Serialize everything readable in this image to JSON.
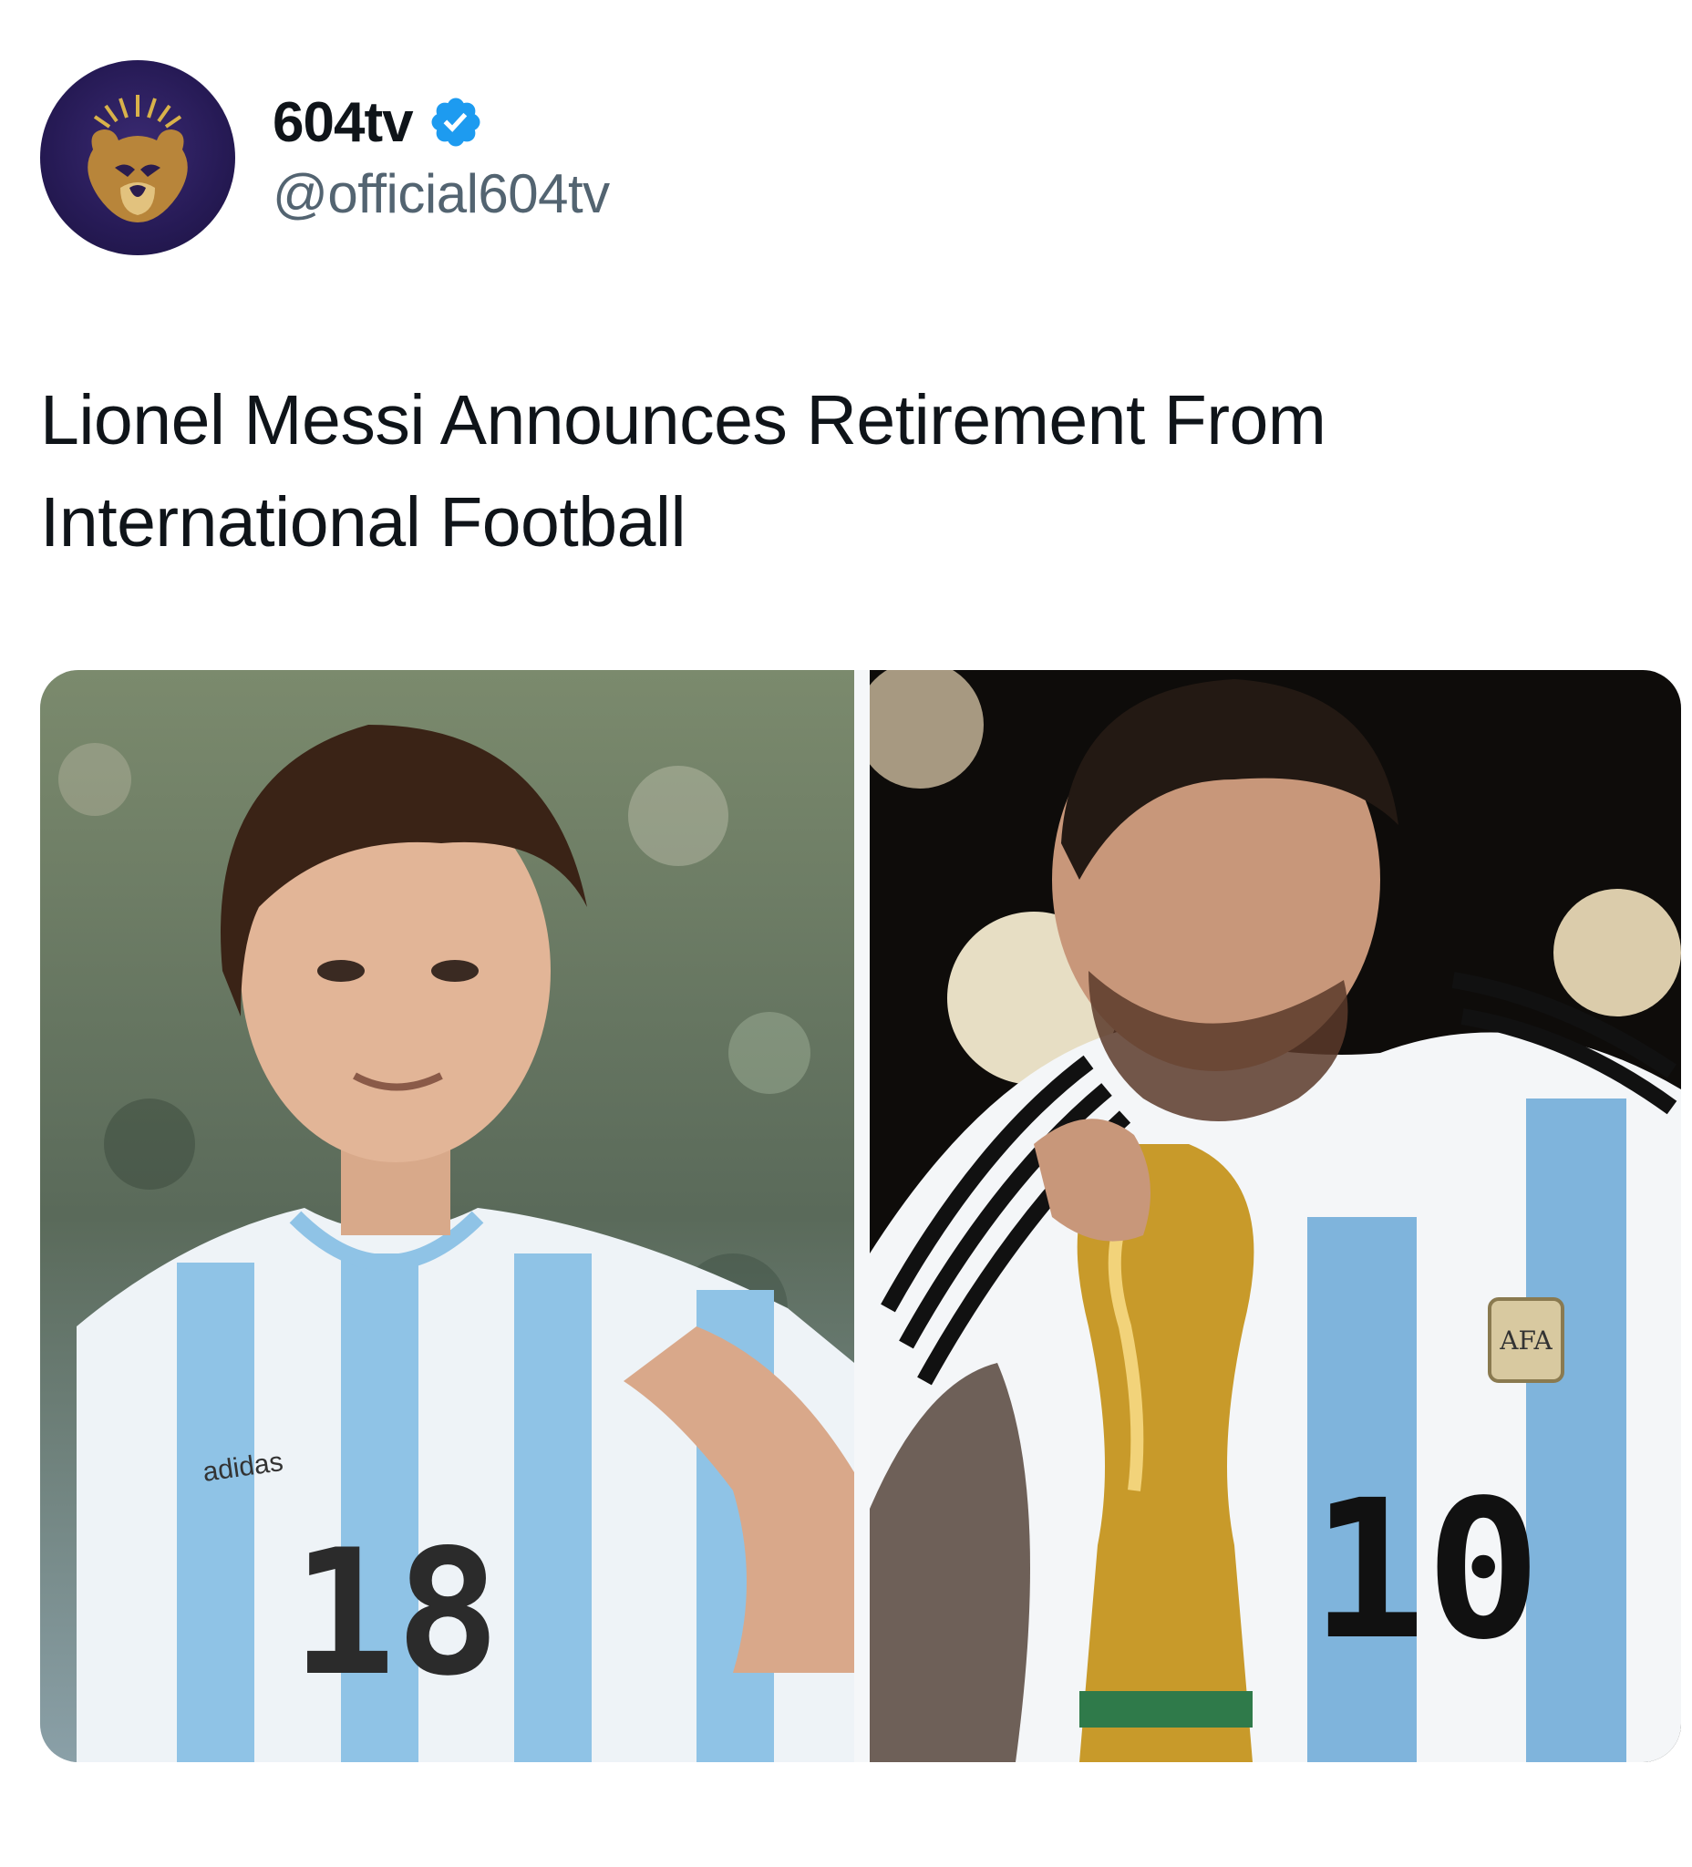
{
  "account": {
    "display_name": "604tv",
    "handle": "@official604tv",
    "verified": true,
    "avatar_icon": "bear-crown-logo-icon",
    "verified_icon": "verified-badge-icon",
    "colors": {
      "verified": "#1d9bf0",
      "avatar_bg": "#261a55",
      "avatar_logo": "#c79a3e"
    }
  },
  "tweet": {
    "text": "Lionel Messi Announces Retirement From International Football"
  },
  "media": {
    "left_photo": {
      "description_icon": "photo-young-player-icon",
      "jersey_number": "18",
      "brand": "adidas"
    },
    "right_photo": {
      "description_icon": "photo-trophy-kiss-icon",
      "jersey_number": "10",
      "badge": "AFA"
    }
  }
}
